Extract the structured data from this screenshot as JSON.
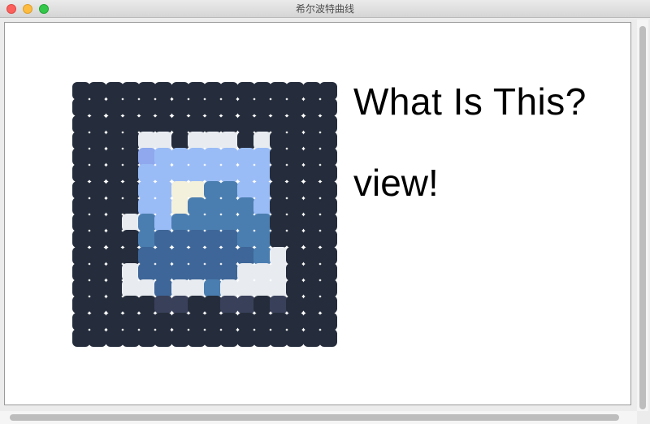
{
  "window": {
    "title": "希尔波特曲线"
  },
  "content": {
    "heading": "What Is This?",
    "subtext": "view!"
  },
  "mosaic": {
    "rows": 16,
    "cols": 16,
    "palette": {
      "D": "#252d3c",
      "W": "#e8ecf1",
      "L": "#9abcf6",
      "M": "#8fa8ee",
      "C": "#f3f0dc",
      "B": "#4b7eb0",
      "N": "#3e6698",
      "G": "#39405a",
      "X": "#ffffff"
    },
    "grid": [
      "DDDDDDDDDDDDDDDD",
      "DDDDDDDDDDDDDDDD",
      "DDDDDDDDDDDDDDDD",
      "DDDDWWDWWWDWDDDD",
      "DDDDMLLLLLLLDDDD",
      "DDDDLLLLLLLLDDDD",
      "DDDDLLCCBBLLDDDD",
      "DDDDLLCBBBBLDDDD",
      "DDDWBLBBBBBBDDDD",
      "DDDDBNNNNNBBDDDD",
      "DDDDNNNNNNNBWDDD",
      "DDDWNNNNNNWWWDDD",
      "DDDWWNWWBWWWWDDD",
      "DDDDDGGDDGGDGDDD",
      "DDDDDDDDDDDDDDDD",
      "DDDDDDDDDDDDDDDD"
    ]
  }
}
